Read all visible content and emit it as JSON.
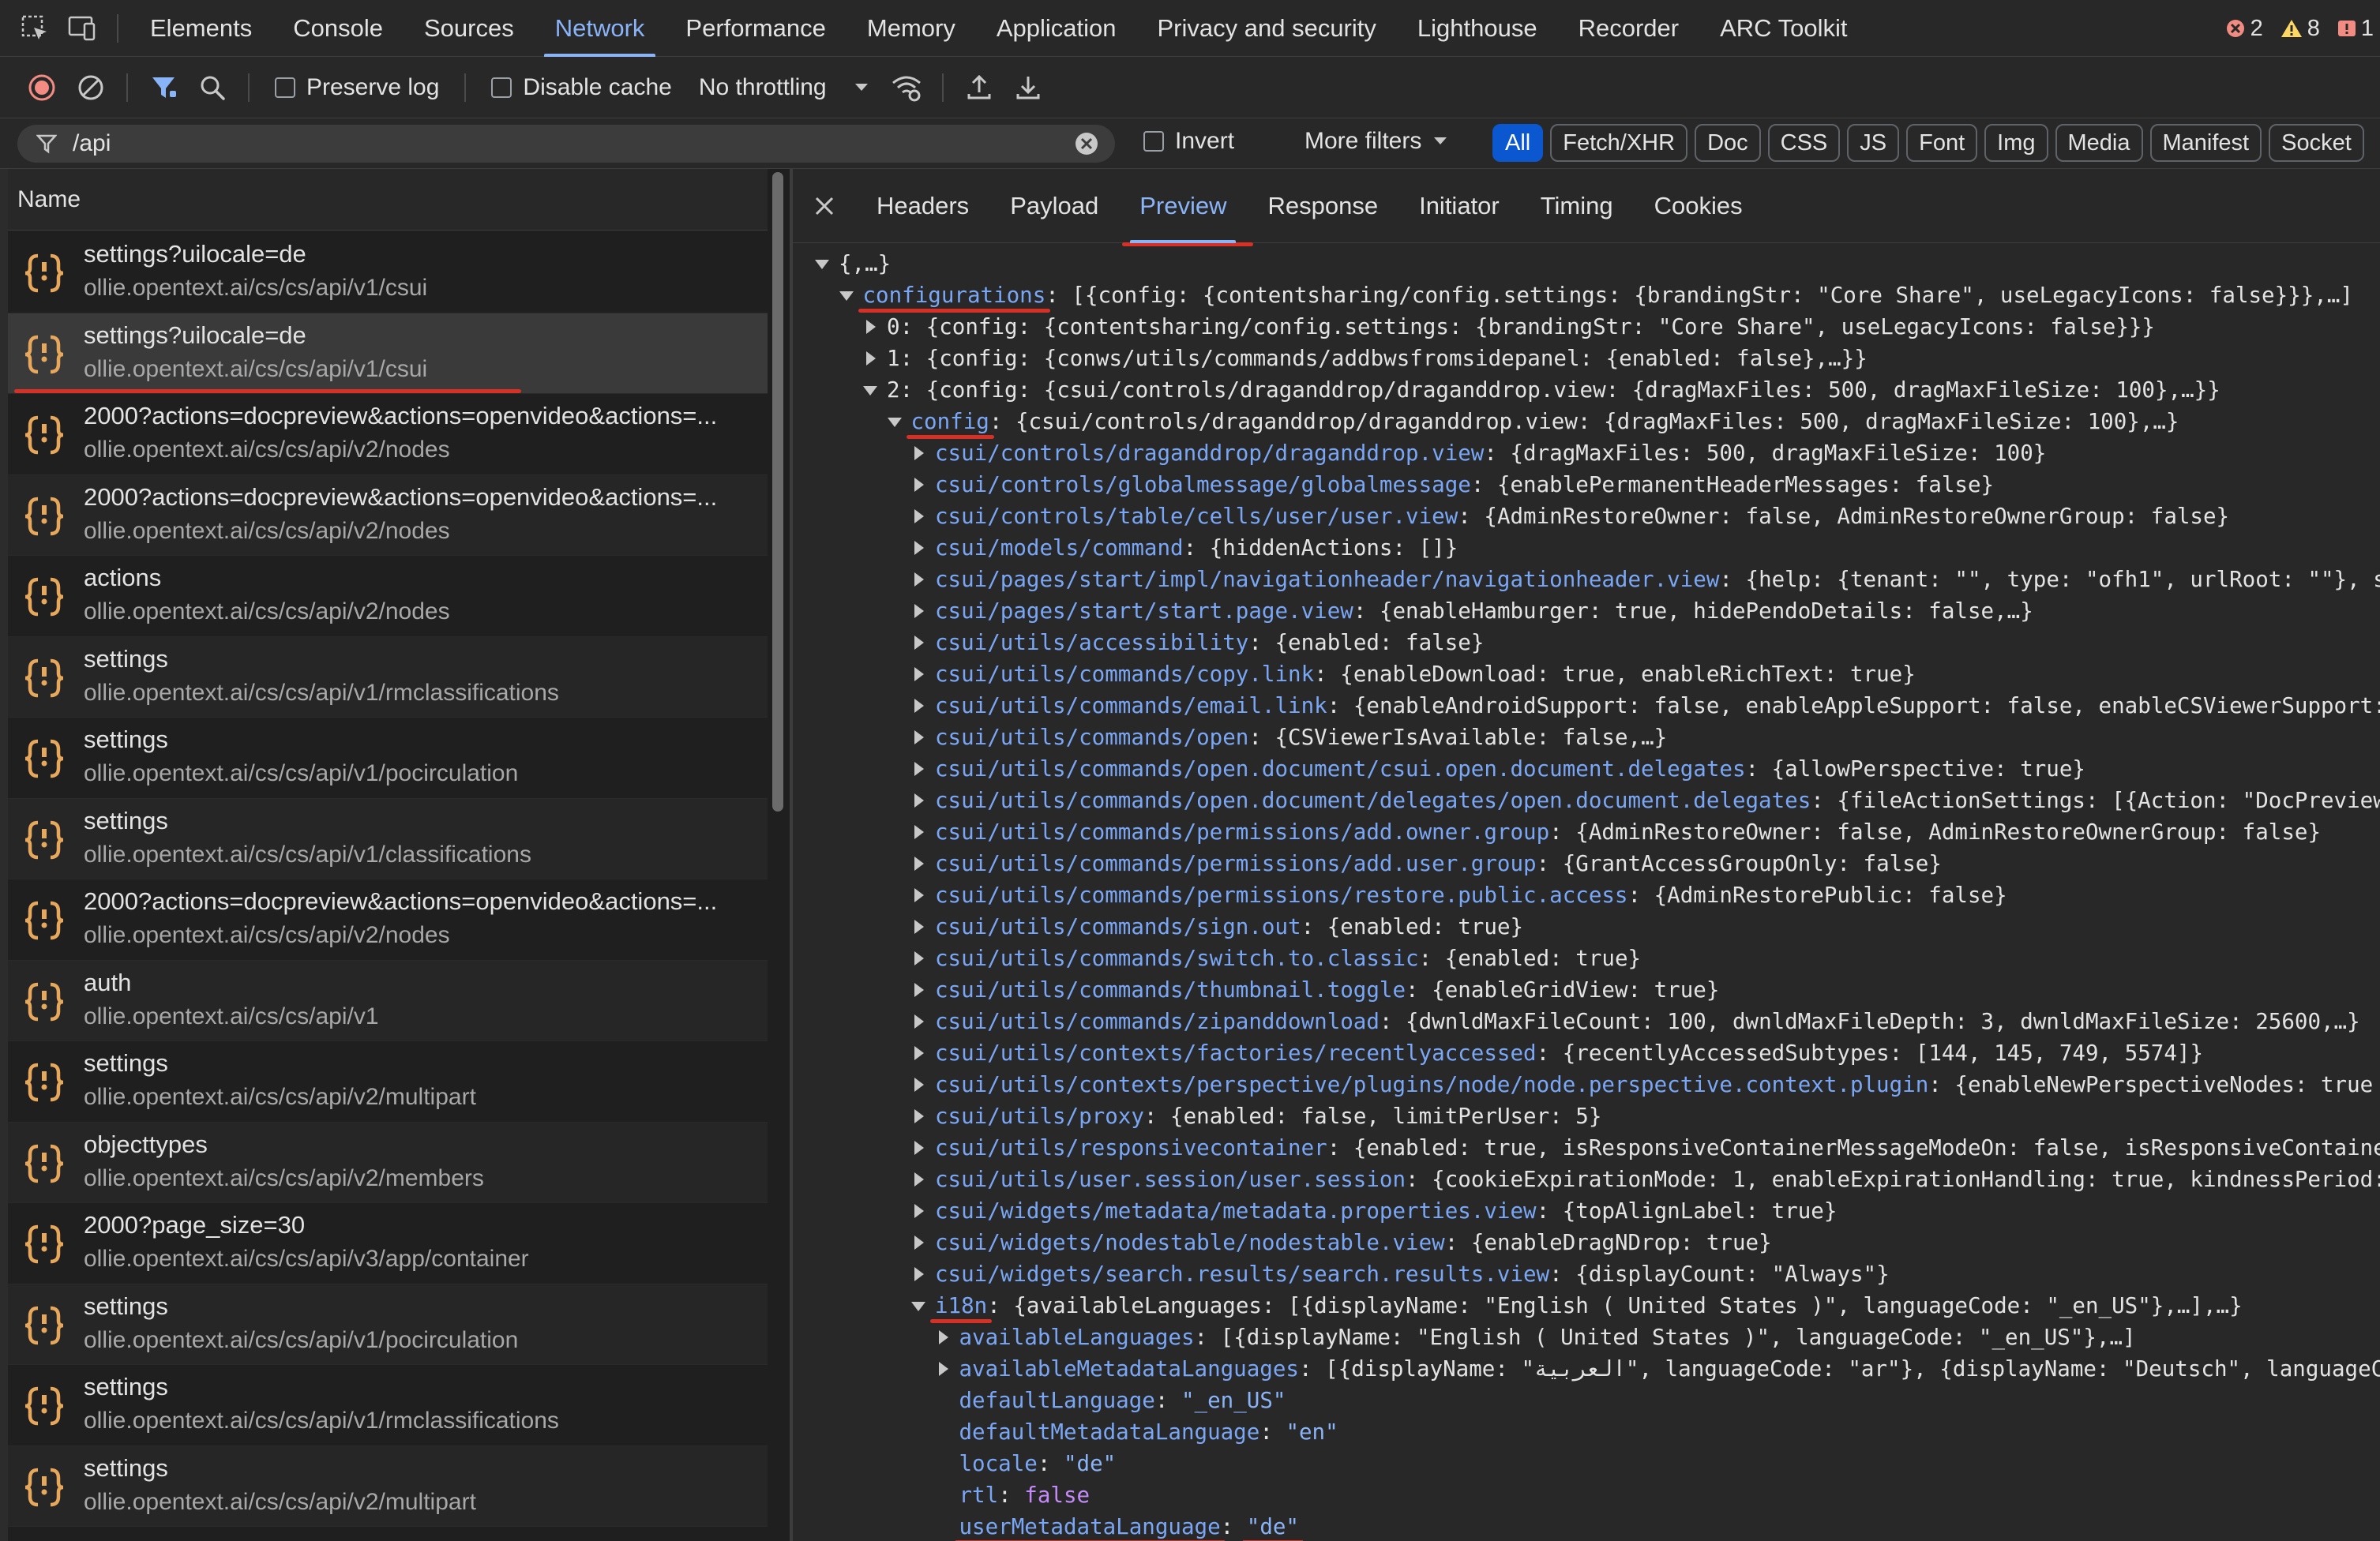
{
  "topbar": {
    "tabs": [
      "Elements",
      "Console",
      "Sources",
      "Network",
      "Performance",
      "Memory",
      "Application",
      "Privacy and security",
      "Lighthouse",
      "Recorder",
      "ARC Toolkit"
    ],
    "active_tab": "Network",
    "errors": "2",
    "warnings": "8",
    "issues": "1"
  },
  "toolbar": {
    "preserve_log": "Preserve log",
    "disable_cache": "Disable cache",
    "throttling": "No throttling"
  },
  "filter": {
    "value": "/api",
    "invert_label": "Invert",
    "more_filters": "More filters",
    "types": [
      "All",
      "Fetch/XHR",
      "Doc",
      "CSS",
      "JS",
      "Font",
      "Img",
      "Media",
      "Manifest",
      "Socket"
    ]
  },
  "requests": {
    "header": "Name",
    "items": [
      {
        "name": "settings?uilocale=de",
        "url": "ollie.opentext.ai/cs/cs/api/v1/csui"
      },
      {
        "name": "settings?uilocale=de",
        "url": "ollie.opentext.ai/cs/cs/api/v1/csui"
      },
      {
        "name": "2000?actions=docpreview&actions=openvideo&actions=...",
        "url": "ollie.opentext.ai/cs/cs/api/v2/nodes"
      },
      {
        "name": "2000?actions=docpreview&actions=openvideo&actions=...",
        "url": "ollie.opentext.ai/cs/cs/api/v2/nodes"
      },
      {
        "name": "actions",
        "url": "ollie.opentext.ai/cs/cs/api/v2/nodes"
      },
      {
        "name": "settings",
        "url": "ollie.opentext.ai/cs/cs/api/v1/rmclassifications"
      },
      {
        "name": "settings",
        "url": "ollie.opentext.ai/cs/cs/api/v1/pocirculation"
      },
      {
        "name": "settings",
        "url": "ollie.opentext.ai/cs/cs/api/v1/classifications"
      },
      {
        "name": "2000?actions=docpreview&actions=openvideo&actions=...",
        "url": "ollie.opentext.ai/cs/cs/api/v2/nodes"
      },
      {
        "name": "auth",
        "url": "ollie.opentext.ai/cs/cs/api/v1"
      },
      {
        "name": "settings",
        "url": "ollie.opentext.ai/cs/cs/api/v2/multipart"
      },
      {
        "name": "objecttypes",
        "url": "ollie.opentext.ai/cs/cs/api/v2/members"
      },
      {
        "name": "2000?page_size=30",
        "url": "ollie.opentext.ai/cs/cs/api/v3/app/container"
      },
      {
        "name": "settings",
        "url": "ollie.opentext.ai/cs/cs/api/v1/pocirculation"
      },
      {
        "name": "settings",
        "url": "ollie.opentext.ai/cs/cs/api/v1/rmclassifications"
      },
      {
        "name": "settings",
        "url": "ollie.opentext.ai/cs/cs/api/v2/multipart"
      }
    ]
  },
  "details": {
    "tabs": [
      "Headers",
      "Payload",
      "Preview",
      "Response",
      "Initiator",
      "Timing",
      "Cookies"
    ],
    "active_tab": "Preview"
  },
  "preview": {
    "lines": [
      {
        "indent": 0,
        "toggle": "open",
        "key": "",
        "value": "{,…}"
      },
      {
        "indent": 1,
        "toggle": "open",
        "key": "configurations",
        "value": "[{config: {contentsharing/config.settings: {brandingStr: \"Core Share\", useLegacyIcons: false}}},…]",
        "underline": true
      },
      {
        "indent": 2,
        "toggle": "closed",
        "key": "0",
        "value": "{config: {contentsharing/config.settings: {brandingStr: \"Core Share\", useLegacyIcons: false}}}",
        "plainkey": true
      },
      {
        "indent": 2,
        "toggle": "closed",
        "key": "1",
        "value": "{config: {conws/utils/commands/addbwsfromsidepanel: {enabled: false},…}}",
        "plainkey": true
      },
      {
        "indent": 2,
        "toggle": "open",
        "key": "2",
        "value": "{config: {csui/controls/draganddrop/draganddrop.view: {dragMaxFiles: 500, dragMaxFileSize: 100},…}}",
        "plainkey": true
      },
      {
        "indent": 3,
        "toggle": "open",
        "key": "config",
        "value": "{csui/controls/draganddrop/draganddrop.view: {dragMaxFiles: 500, dragMaxFileSize: 100},…}",
        "underline": true
      },
      {
        "indent": 4,
        "toggle": "closed",
        "key": "csui/controls/draganddrop/draganddrop.view",
        "value": "{dragMaxFiles: 500, dragMaxFileSize: 100}"
      },
      {
        "indent": 4,
        "toggle": "closed",
        "key": "csui/controls/globalmessage/globalmessage",
        "value": "{enablePermanentHeaderMessages: false}"
      },
      {
        "indent": 4,
        "toggle": "closed",
        "key": "csui/controls/table/cells/user/user.view",
        "value": "{AdminRestoreOwner: false, AdminRestoreOwnerGroup: false}"
      },
      {
        "indent": 4,
        "toggle": "closed",
        "key": "csui/models/command",
        "value": "{hiddenActions: []}"
      },
      {
        "indent": 4,
        "toggle": "closed",
        "key": "csui/pages/start/impl/navigationheader/navigationheader.view",
        "value": "{help: {tenant: \"\", type: \"ofh1\", urlRoot: \"\"}, s"
      },
      {
        "indent": 4,
        "toggle": "closed",
        "key": "csui/pages/start/start.page.view",
        "value": "{enableHamburger: true, hidePendoDetails: false,…}"
      },
      {
        "indent": 4,
        "toggle": "closed",
        "key": "csui/utils/accessibility",
        "value": "{enabled: false}"
      },
      {
        "indent": 4,
        "toggle": "closed",
        "key": "csui/utils/commands/copy.link",
        "value": "{enableDownload: true, enableRichText: true}"
      },
      {
        "indent": 4,
        "toggle": "closed",
        "key": "csui/utils/commands/email.link",
        "value": "{enableAndroidSupport: false, enableAppleSupport: false, enableCSViewerSupport:"
      },
      {
        "indent": 4,
        "toggle": "closed",
        "key": "csui/utils/commands/open",
        "value": "{CSViewerIsAvailable: false,…}"
      },
      {
        "indent": 4,
        "toggle": "closed",
        "key": "csui/utils/commands/open.document/csui.open.document.delegates",
        "value": "{allowPerspective: true}"
      },
      {
        "indent": 4,
        "toggle": "closed",
        "key": "csui/utils/commands/open.document/delegates/open.document.delegates",
        "value": "{fileActionSettings: [{Action: \"DocPreview"
      },
      {
        "indent": 4,
        "toggle": "closed",
        "key": "csui/utils/commands/permissions/add.owner.group",
        "value": "{AdminRestoreOwner: false, AdminRestoreOwnerGroup: false}"
      },
      {
        "indent": 4,
        "toggle": "closed",
        "key": "csui/utils/commands/permissions/add.user.group",
        "value": "{GrantAccessGroupOnly: false}"
      },
      {
        "indent": 4,
        "toggle": "closed",
        "key": "csui/utils/commands/permissions/restore.public.access",
        "value": "{AdminRestorePublic: false}"
      },
      {
        "indent": 4,
        "toggle": "closed",
        "key": "csui/utils/commands/sign.out",
        "value": "{enabled: true}"
      },
      {
        "indent": 4,
        "toggle": "closed",
        "key": "csui/utils/commands/switch.to.classic",
        "value": "{enabled: true}"
      },
      {
        "indent": 4,
        "toggle": "closed",
        "key": "csui/utils/commands/thumbnail.toggle",
        "value": "{enableGridView: true}"
      },
      {
        "indent": 4,
        "toggle": "closed",
        "key": "csui/utils/commands/zipanddownload",
        "value": "{dwnldMaxFileCount: 100, dwnldMaxFileDepth: 3, dwnldMaxFileSize: 25600,…}"
      },
      {
        "indent": 4,
        "toggle": "closed",
        "key": "csui/utils/contexts/factories/recentlyaccessed",
        "value": "{recentlyAccessedSubtypes: [144, 145, 749, 5574]}"
      },
      {
        "indent": 4,
        "toggle": "closed",
        "key": "csui/utils/contexts/perspective/plugins/node/node.perspective.context.plugin",
        "value": "{enableNewPerspectiveNodes: true"
      },
      {
        "indent": 4,
        "toggle": "closed",
        "key": "csui/utils/proxy",
        "value": "{enabled: false, limitPerUser: 5}"
      },
      {
        "indent": 4,
        "toggle": "closed",
        "key": "csui/utils/responsivecontainer",
        "value": "{enabled: true, isResponsiveContainerMessageModeOn: false, isResponsiveContaine"
      },
      {
        "indent": 4,
        "toggle": "closed",
        "key": "csui/utils/user.session/user.session",
        "value": "{cookieExpirationMode: 1, enableExpirationHandling: true, kindnessPeriod:"
      },
      {
        "indent": 4,
        "toggle": "closed",
        "key": "csui/widgets/metadata/metadata.properties.view",
        "value": "{topAlignLabel: true}"
      },
      {
        "indent": 4,
        "toggle": "closed",
        "key": "csui/widgets/nodestable/nodestable.view",
        "value": "{enableDragNDrop: true}"
      },
      {
        "indent": 4,
        "toggle": "closed",
        "key": "csui/widgets/search.results/search.results.view",
        "value": "{displayCount: \"Always\"}"
      },
      {
        "indent": 4,
        "toggle": "open",
        "key": "i18n",
        "value": "{availableLanguages: [{displayName: \"English ( United States )\", languageCode: \"_en_US\"},…],…}",
        "underline": true
      },
      {
        "indent": 5,
        "toggle": "closed",
        "key": "availableLanguages",
        "value": "[{displayName: \"English ( United States )\", languageCode: \"_en_US\"},…]"
      },
      {
        "indent": 5,
        "toggle": "closed",
        "key": "availableMetadataLanguages",
        "value": "[{displayName: \"العربية\", languageCode: \"ar\"}, {displayName: \"Deutsch\", languageC"
      },
      {
        "indent": 5,
        "toggle": "none",
        "key": "defaultLanguage",
        "value": "\"_en_US\"",
        "vtype": "s"
      },
      {
        "indent": 5,
        "toggle": "none",
        "key": "defaultMetadataLanguage",
        "value": "\"en\"",
        "vtype": "s"
      },
      {
        "indent": 5,
        "toggle": "none",
        "key": "locale",
        "value": "\"de\"",
        "vtype": "s"
      },
      {
        "indent": 5,
        "toggle": "none",
        "key": "rtl",
        "value": "false",
        "vtype": "b"
      },
      {
        "indent": 5,
        "toggle": "none",
        "key": "userMetadataLanguage",
        "value": "\"de\"",
        "vtype": "s",
        "underline": true
      }
    ]
  },
  "colors": {
    "accent": "#8ab4f8",
    "error": "#f28b82",
    "warning": "#fdd663",
    "record": "#f28b82",
    "icon_orange": "#e8a85c",
    "annotation_underline": "#d93025"
  }
}
